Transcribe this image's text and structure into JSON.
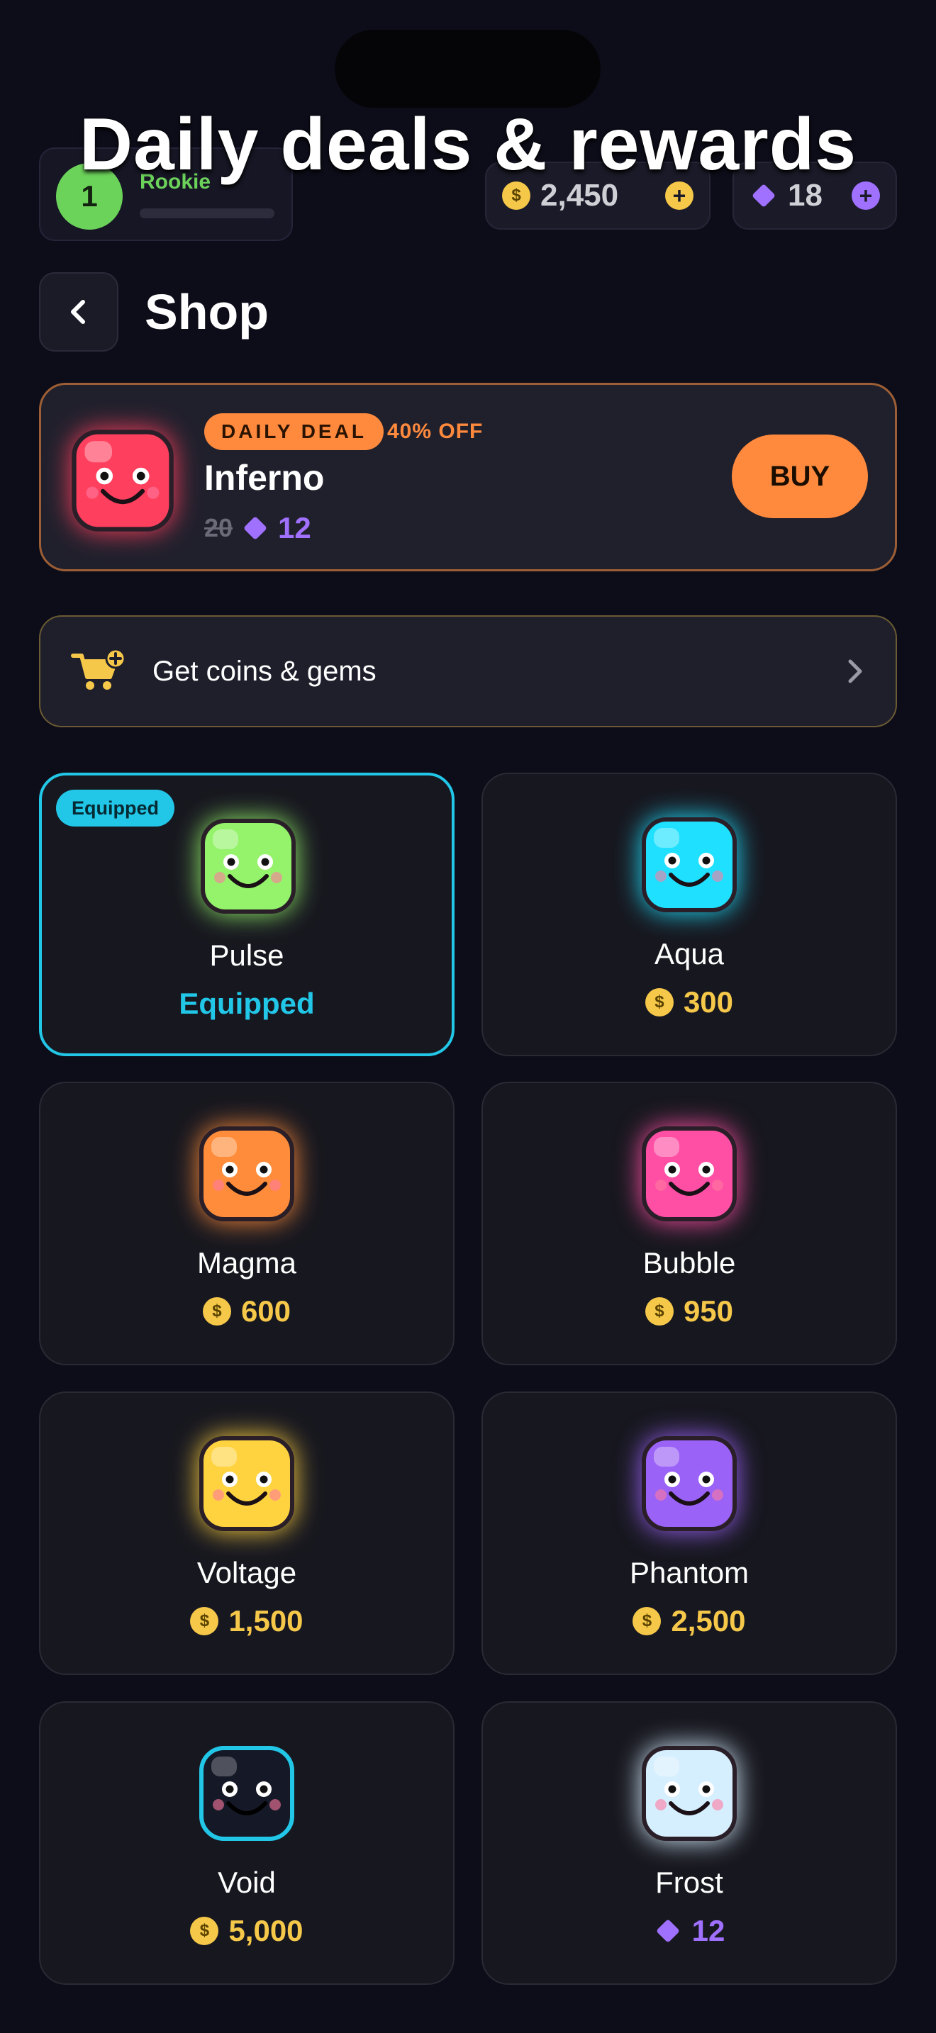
{
  "overlay_title": "Daily deals & rewards",
  "hud": {
    "level": "1",
    "rank": "Rookie",
    "xp_progress": 0,
    "coins": "2,450",
    "gems": "18",
    "coin_symbol": "$"
  },
  "header": {
    "title": "Shop"
  },
  "daily_deal": {
    "badge": "DAILY DEAL",
    "discount": "40% OFF",
    "name": "Inferno",
    "old_price": "20",
    "new_price": "12",
    "buy_label": "BUY",
    "color": "#ff3f5e"
  },
  "get_coins": {
    "label": "Get coins & gems"
  },
  "colors": {
    "accent_orange": "#ff8a3d",
    "accent_cyan": "#22c7e8",
    "gem_purple": "#a070ff",
    "coin_gold": "#f6c84a"
  },
  "items": [
    {
      "name": "Pulse",
      "color": "#94f36a",
      "state": "equipped",
      "badge": "Equipped",
      "price": "Equipped",
      "currency": "none"
    },
    {
      "name": "Aqua",
      "color": "#1fe0ff",
      "state": "buy",
      "price": "300",
      "currency": "coin"
    },
    {
      "name": "Magma",
      "color": "#ff8c3a",
      "state": "buy",
      "price": "600",
      "currency": "coin"
    },
    {
      "name": "Bubble",
      "color": "#ff4fa4",
      "state": "buy",
      "price": "950",
      "currency": "coin"
    },
    {
      "name": "Voltage",
      "color": "#ffd340",
      "state": "buy",
      "price": "1,500",
      "currency": "coin"
    },
    {
      "name": "Phantom",
      "color": "#9a62f6",
      "state": "buy",
      "price": "2,500",
      "currency": "coin"
    },
    {
      "name": "Void",
      "color": "#151826",
      "state": "buy",
      "price": "5,000",
      "currency": "coin"
    },
    {
      "name": "Frost",
      "color": "#d6efff",
      "state": "buy",
      "price": "12",
      "currency": "gem"
    }
  ]
}
